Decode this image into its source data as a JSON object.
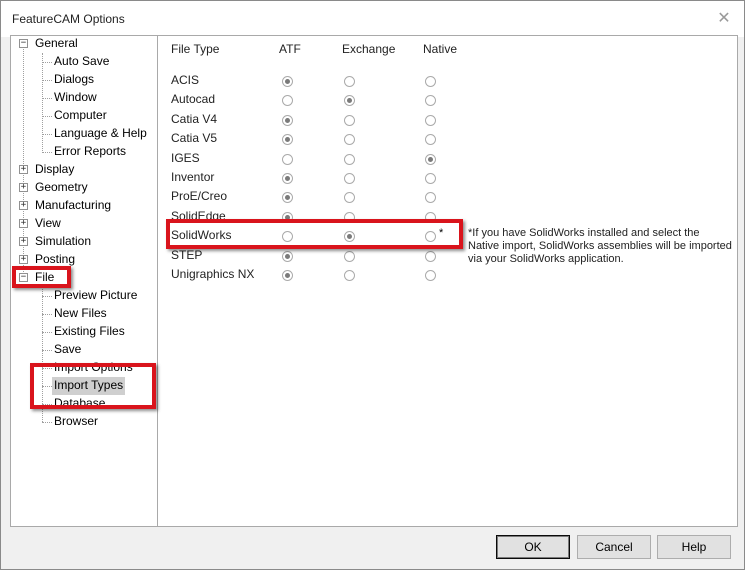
{
  "window": {
    "title": "FeatureCAM Options"
  },
  "tree": {
    "general": "General",
    "auto_save": "Auto Save",
    "dialogs": "Dialogs",
    "window": "Window",
    "computer": "Computer",
    "language_help": "Language & Help",
    "error_reports": "Error Reports",
    "display": "Display",
    "geometry": "Geometry",
    "manufacturing": "Manufacturing",
    "view": "View",
    "simulation": "Simulation",
    "posting": "Posting",
    "file": "File",
    "preview_picture": "Preview Picture",
    "new_files": "New Files",
    "existing_files": "Existing Files",
    "save": "Save",
    "import_options": "Import Options",
    "import_types": "Import Types",
    "database": "Database",
    "browser": "Browser"
  },
  "table": {
    "headers": {
      "file_type": "File Type",
      "atf": "ATF",
      "exchange": "Exchange",
      "native": "Native"
    },
    "rows": [
      {
        "label": "ACIS",
        "selected": "ATF"
      },
      {
        "label": "Autocad",
        "selected": "Exchange"
      },
      {
        "label": "Catia V4",
        "selected": "ATF"
      },
      {
        "label": "Catia V5",
        "selected": "ATF"
      },
      {
        "label": "IGES",
        "selected": "Native"
      },
      {
        "label": "Inventor",
        "selected": "ATF"
      },
      {
        "label": "ProE/Creo",
        "selected": "ATF"
      },
      {
        "label": "SolidEdge",
        "selected": "ATF"
      },
      {
        "label": "SolidWorks",
        "selected": "Exchange",
        "native_note": "*"
      },
      {
        "label": "STEP",
        "selected": "ATF"
      },
      {
        "label": "Unigraphics NX",
        "selected": "ATF"
      }
    ]
  },
  "note": "*If you have SolidWorks installed and select the Native import, SolidWorks assemblies will be imported via your SolidWorks application.",
  "buttons": {
    "ok": "OK",
    "cancel": "Cancel",
    "help": "Help"
  },
  "colors": {
    "highlight": "#d9141c",
    "selection": "#cfcfcf"
  }
}
